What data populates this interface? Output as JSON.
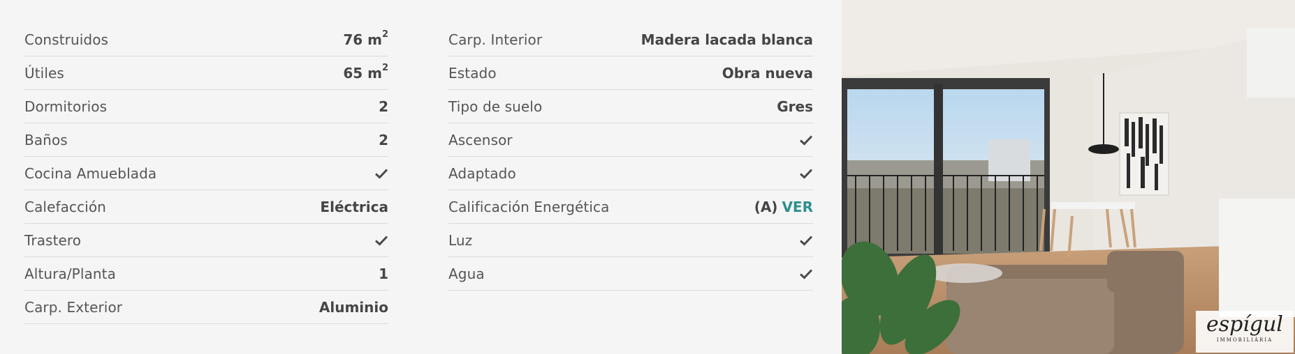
{
  "left_specs": [
    {
      "label": "Construidos",
      "value": "76 m",
      "unit_sup": "2",
      "check": false
    },
    {
      "label": "Útiles",
      "value": "65 m",
      "unit_sup": "2",
      "check": false
    },
    {
      "label": "Dormitorios",
      "value": "2",
      "check": false
    },
    {
      "label": "Baños",
      "value": "2",
      "check": false
    },
    {
      "label": "Cocina Amueblada",
      "value": "",
      "check": true
    },
    {
      "label": "Calefacción",
      "value": "Eléctrica",
      "check": false
    },
    {
      "label": "Trastero",
      "value": "",
      "check": true
    },
    {
      "label": "Altura/Planta",
      "value": "1",
      "check": false
    },
    {
      "label": "Carp. Exterior",
      "value": "Aluminio",
      "check": false
    }
  ],
  "right_specs": [
    {
      "label": "Carp. Interior",
      "value": "Madera lacada blanca",
      "check": false
    },
    {
      "label": "Estado",
      "value": "Obra nueva",
      "check": false
    },
    {
      "label": "Tipo de suelo",
      "value": "Gres",
      "check": false
    },
    {
      "label": "Ascensor",
      "value": "",
      "check": true
    },
    {
      "label": "Adaptado",
      "value": "",
      "check": true
    },
    {
      "label": "Calificación Energética",
      "value": "(A)",
      "link": "VER",
      "check": false
    },
    {
      "label": "Luz",
      "value": "",
      "check": true
    },
    {
      "label": "Agua",
      "value": "",
      "check": true
    }
  ],
  "photo": {
    "logo_text": "espígul",
    "logo_subtext": "IMMOBILIÀRIA"
  },
  "colors": {
    "accent": "#2e8f8f",
    "text": "#4a4a4a",
    "divider": "#d9d9d9",
    "background": "#f5f5f5"
  },
  "icons": {
    "check": "check-icon"
  }
}
